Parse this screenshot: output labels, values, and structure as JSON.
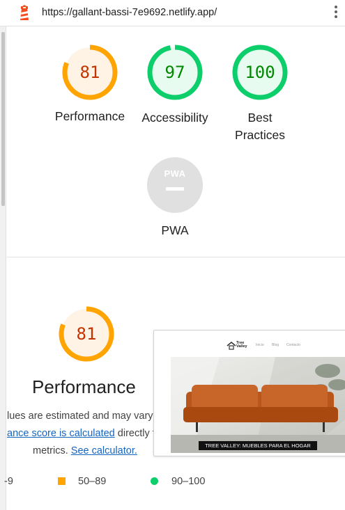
{
  "browser": {
    "url": "https://gallant-bassi-7e9692.netlify.app/",
    "logo_icon": "lighthouse-icon",
    "menu_icon": "kebab-menu-icon"
  },
  "colors": {
    "average": "#ffa400",
    "average_text": "#c33300",
    "average_fill": "#fff3e6",
    "pass": "#0cce6b",
    "pass_text": "#008800",
    "pass_fill": "#e8fbf0",
    "na": "#e0e0e0",
    "link": "#1565c0"
  },
  "scores": {
    "performance": {
      "value": "81",
      "label": "Performance",
      "fraction": 0.81
    },
    "accessibility": {
      "value": "97",
      "label": "Accessibility",
      "fraction": 0.97
    },
    "best_practices": {
      "value": "100",
      "label_line1": "Best",
      "label_line2": "Practices",
      "fraction": 1.0
    },
    "pwa": {
      "badge": "PWA",
      "label": "PWA"
    }
  },
  "detail": {
    "score": "81",
    "fraction": 0.81,
    "title": "Performance",
    "desc_line1": "lues are estimated and may vary",
    "desc_link1": "ance score is calculated",
    "desc_after_link1": " directly f",
    "desc_line3_prefix": "metrics. ",
    "desc_link2": "See calculator."
  },
  "legend": {
    "fail_range": "-9",
    "average_range": "50–89",
    "pass_range": "90–100"
  },
  "screenshot_thumbnail": {
    "brand_line1": "Tree",
    "brand_line2": "Valley",
    "nav": [
      "Inicio",
      "Blog",
      "Contacto"
    ],
    "caption": "TREE VALLEY: MUEBLES PARA EL HOGAR"
  }
}
